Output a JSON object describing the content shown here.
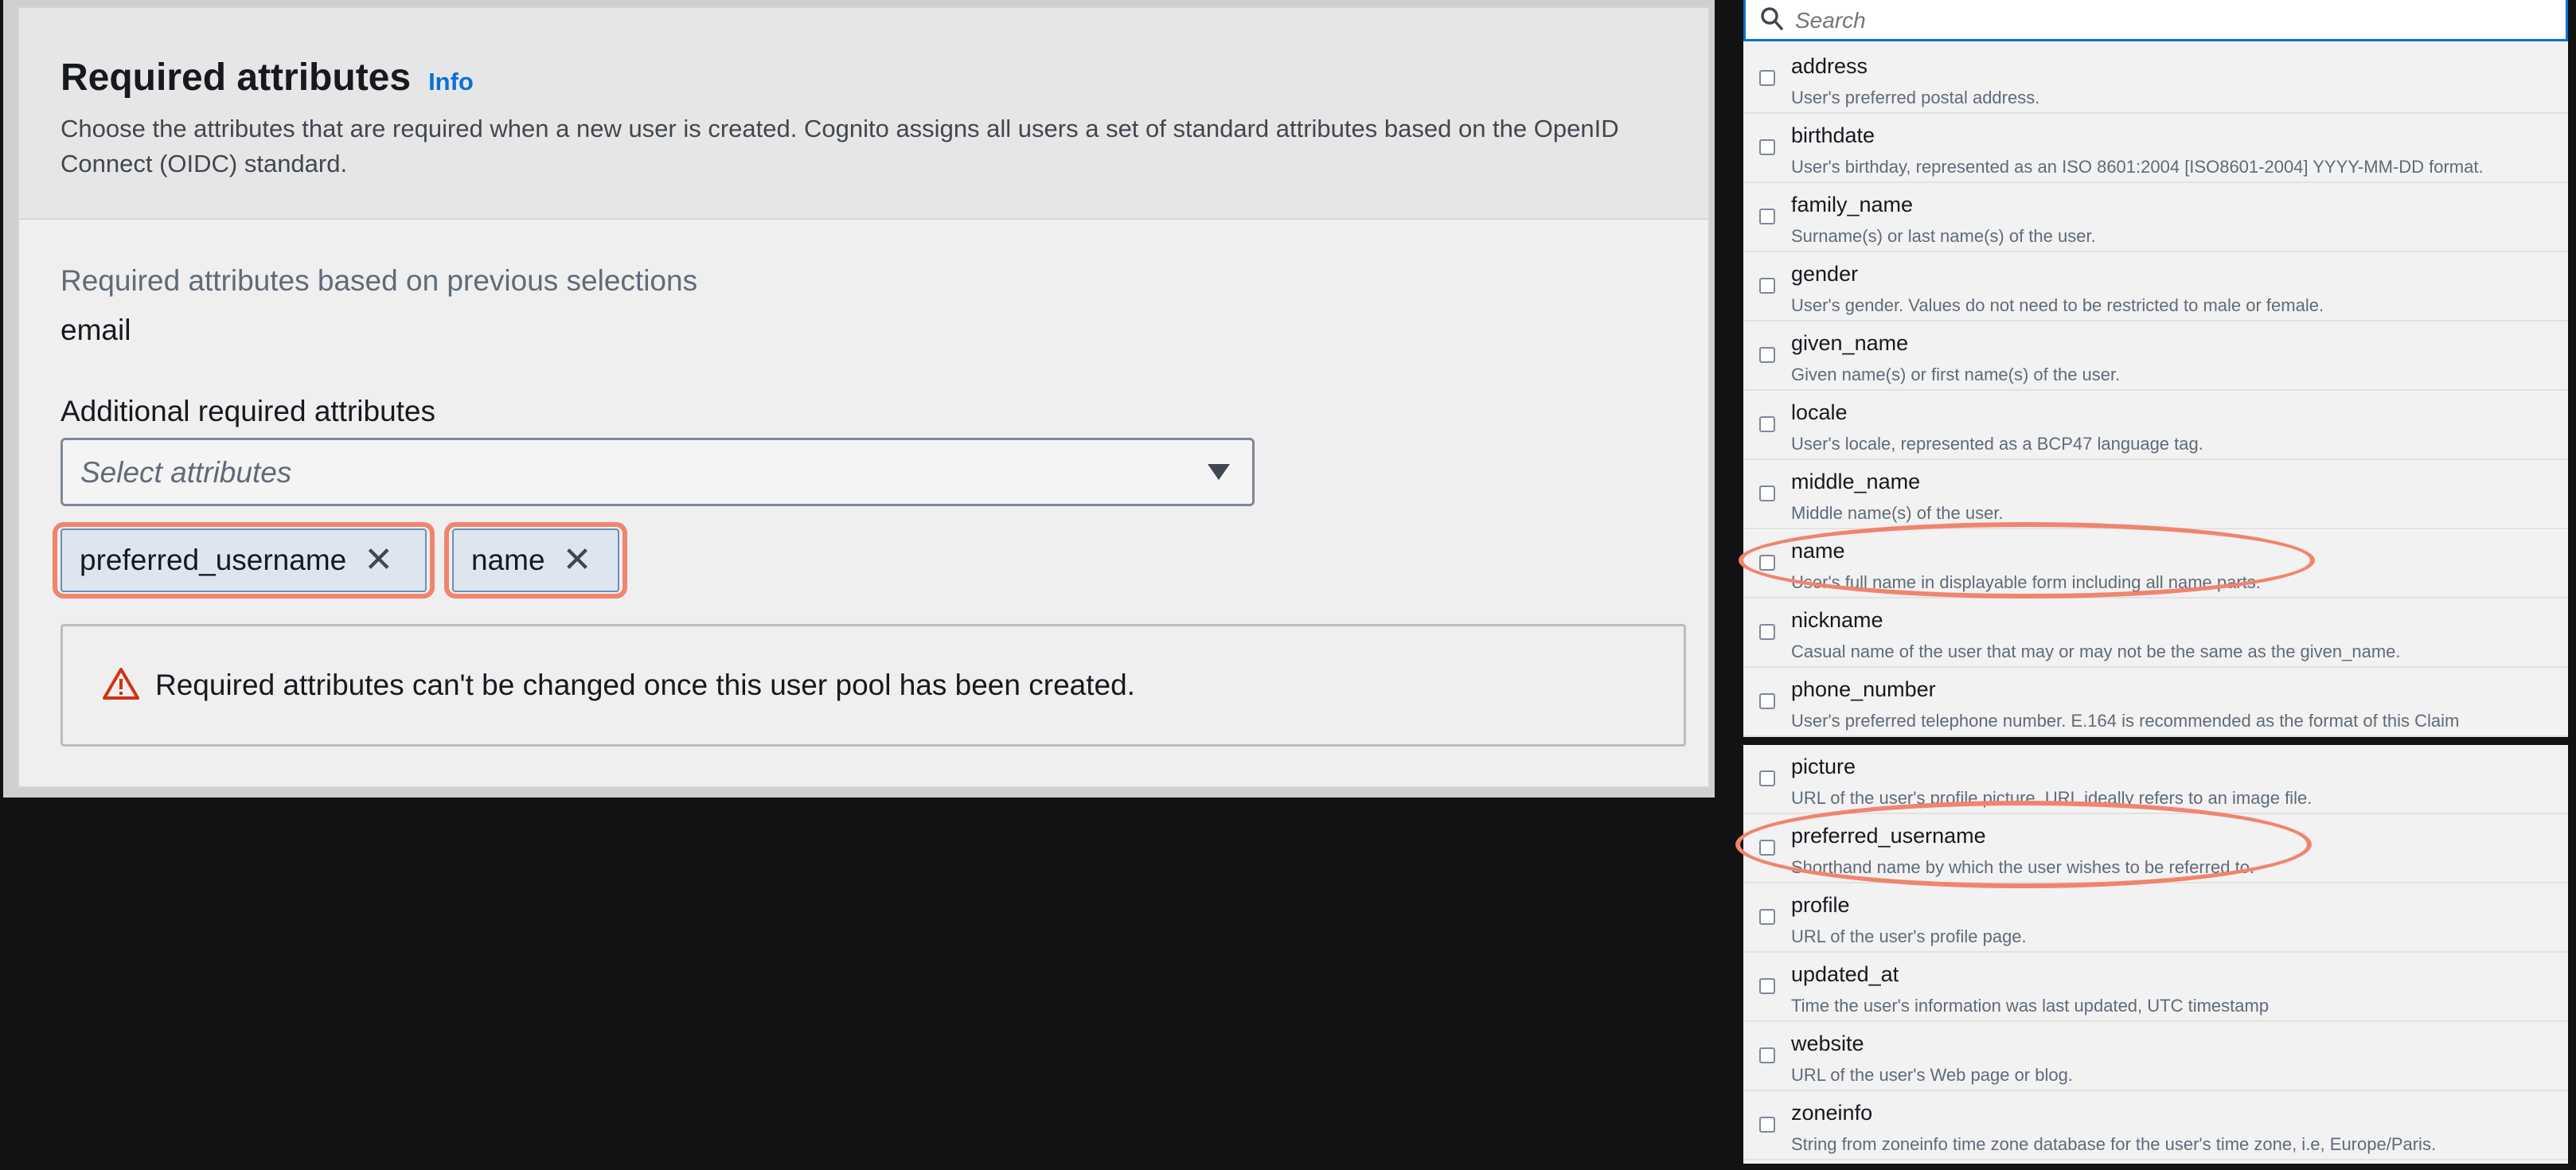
{
  "section": {
    "title": "Required attributes",
    "info_link": "Info",
    "description": "Choose the attributes that are required when a new user is created. Cognito assigns all users a set of standard attributes based on the OpenID Connect (OIDC) standard.",
    "previous_label": "Required attributes based on previous selections",
    "previous_value": "email",
    "additional_label": "Additional required attributes",
    "select_placeholder": "Select attributes",
    "tokens": [
      {
        "label": "preferred_username"
      },
      {
        "label": "name"
      }
    ],
    "alert_text": "Required attributes can't be changed once this user pool has been created."
  },
  "dropdown": {
    "search_placeholder": "Search",
    "options": [
      {
        "name": "address",
        "desc": "User's preferred postal address."
      },
      {
        "name": "birthdate",
        "desc": "User's birthday, represented as an ISO 8601:2004 [ISO8601-2004] YYYY-MM-DD format."
      },
      {
        "name": "family_name",
        "desc": "Surname(s) or last name(s) of the user."
      },
      {
        "name": "gender",
        "desc": "User's gender. Values do not need to be restricted to male or female."
      },
      {
        "name": "given_name",
        "desc": "Given name(s) or first name(s) of the user."
      },
      {
        "name": "locale",
        "desc": "User's locale, represented as a BCP47 language tag."
      },
      {
        "name": "middle_name",
        "desc": "Middle name(s) of the user."
      },
      {
        "name": "name",
        "desc": "User's full name in displayable form including all name parts."
      },
      {
        "name": "nickname",
        "desc": "Casual name of the user that may or may not be the same as the given_name."
      },
      {
        "name": "phone_number",
        "desc": "User's preferred telephone number. E.164 is recommended as the format of this Claim"
      },
      {
        "name": "picture",
        "desc": "URL of the user's profile picture. URL ideally refers to an image file."
      },
      {
        "name": "preferred_username",
        "desc": "Shorthand name by which the user wishes to be referred to."
      },
      {
        "name": "profile",
        "desc": "URL of the user's profile page."
      },
      {
        "name": "updated_at",
        "desc": "Time the user's information was last updated, UTC timestamp"
      },
      {
        "name": "website",
        "desc": "URL of the user's Web page or blog."
      },
      {
        "name": "zoneinfo",
        "desc": "String from zoneinfo time zone database for the user's time zone, i.e, Europe/Paris."
      }
    ]
  },
  "colors": {
    "highlight": "#f1846d",
    "link": "#0972d3",
    "warning": "#d13212"
  }
}
